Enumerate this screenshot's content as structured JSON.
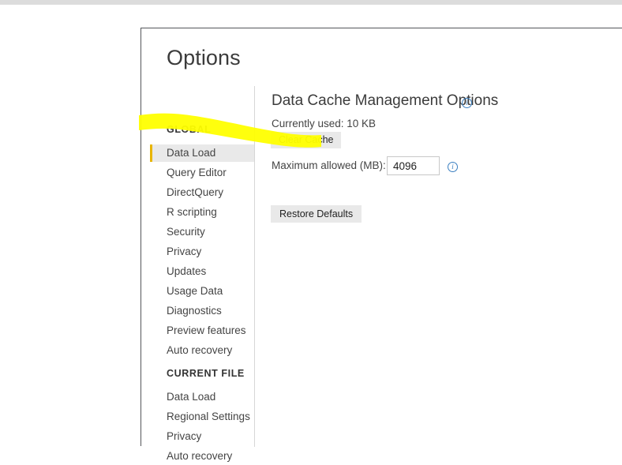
{
  "dialog": {
    "title": "Options"
  },
  "nav": {
    "groups": [
      {
        "title": "GLOBAL",
        "items": [
          {
            "label": "Data Load",
            "selected": true
          },
          {
            "label": "Query Editor",
            "selected": false
          },
          {
            "label": "DirectQuery",
            "selected": false
          },
          {
            "label": "R scripting",
            "selected": false
          },
          {
            "label": "Security",
            "selected": false
          },
          {
            "label": "Privacy",
            "selected": false
          },
          {
            "label": "Updates",
            "selected": false
          },
          {
            "label": "Usage Data",
            "selected": false
          },
          {
            "label": "Diagnostics",
            "selected": false
          },
          {
            "label": "Preview features",
            "selected": false
          },
          {
            "label": "Auto recovery",
            "selected": false
          }
        ]
      },
      {
        "title": "CURRENT FILE",
        "items": [
          {
            "label": "Data Load",
            "selected": false
          },
          {
            "label": "Regional Settings",
            "selected": false
          },
          {
            "label": "Privacy",
            "selected": false
          },
          {
            "label": "Auto recovery",
            "selected": false
          }
        ]
      }
    ]
  },
  "content": {
    "heading": "Data Cache Management Options",
    "heading_info_icon": "info-icon",
    "cache_used_label": "Currently used: 10 KB",
    "clear_cache_label": "Clear Cache",
    "max_allowed_label": "Maximum allowed (MB):",
    "max_allowed_value": "4096",
    "max_allowed_placeholder": "",
    "max_allowed_info_icon": "info-icon",
    "restore_defaults_label": "Restore Defaults"
  },
  "annotation": {
    "highlighter_color": "#ffff00",
    "accent_color": "#e8b500",
    "info_icon_color": "#3a7fc1",
    "selected_row_color": "#e9e9e9"
  }
}
